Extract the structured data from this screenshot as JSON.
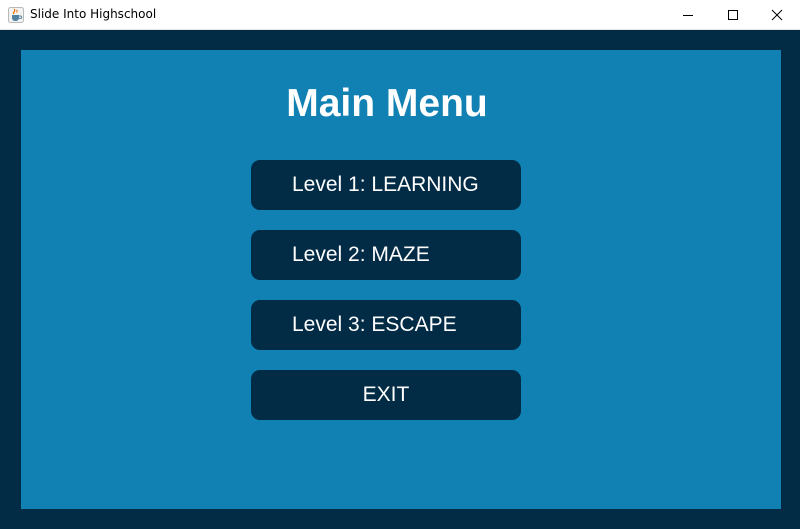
{
  "window": {
    "title": "Slide Into Highschool",
    "app_icon": "java-cup-icon",
    "controls": [
      "minimize-icon",
      "maximize-icon",
      "close-icon"
    ]
  },
  "colors": {
    "frame": "#022b46",
    "panel": "#1081b2",
    "button": "#022b46",
    "text": "#ffffff"
  },
  "menu": {
    "title": "Main Menu",
    "buttons": [
      {
        "label": "Level 1: LEARNING"
      },
      {
        "label": "Level 2: MAZE"
      },
      {
        "label": "Level 3: ESCAPE"
      },
      {
        "label": "EXIT"
      }
    ]
  }
}
